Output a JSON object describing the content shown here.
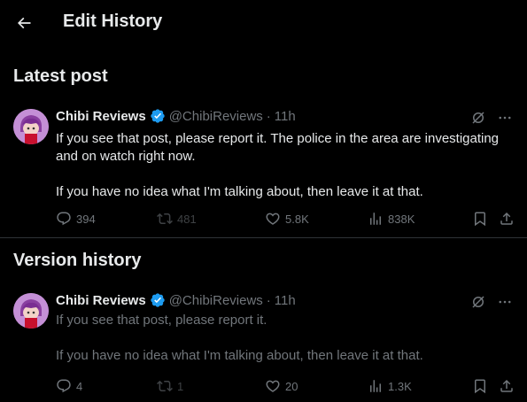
{
  "header": {
    "title": "Edit History"
  },
  "latest": {
    "section_title": "Latest post",
    "author": "Chibi Reviews",
    "handle": "@ChibiReviews",
    "separator": "·",
    "time": "11h",
    "paragraphs": [
      "If you see that post, please report it. The police in the area are investigating and on watch right now.",
      "If you have no idea what I'm talking about, then leave it at that."
    ],
    "stats": {
      "replies": "394",
      "reposts": "481",
      "likes": "5.8K",
      "views": "838K"
    }
  },
  "history": {
    "section_title": "Version history",
    "author": "Chibi Reviews",
    "handle": "@ChibiReviews",
    "separator": "·",
    "time": "11h",
    "paragraphs": [
      "If you see that post, please report it.",
      "If you have no idea what I'm talking about, then leave it at that."
    ],
    "stats": {
      "replies": "4",
      "reposts": "1",
      "likes": "20",
      "views": "1.3K"
    }
  },
  "colors": {
    "background": "#000000",
    "text_primary": "#e7e9ea",
    "text_secondary": "#71767b",
    "verified": "#1d9bf0",
    "divider": "#2f3336"
  }
}
